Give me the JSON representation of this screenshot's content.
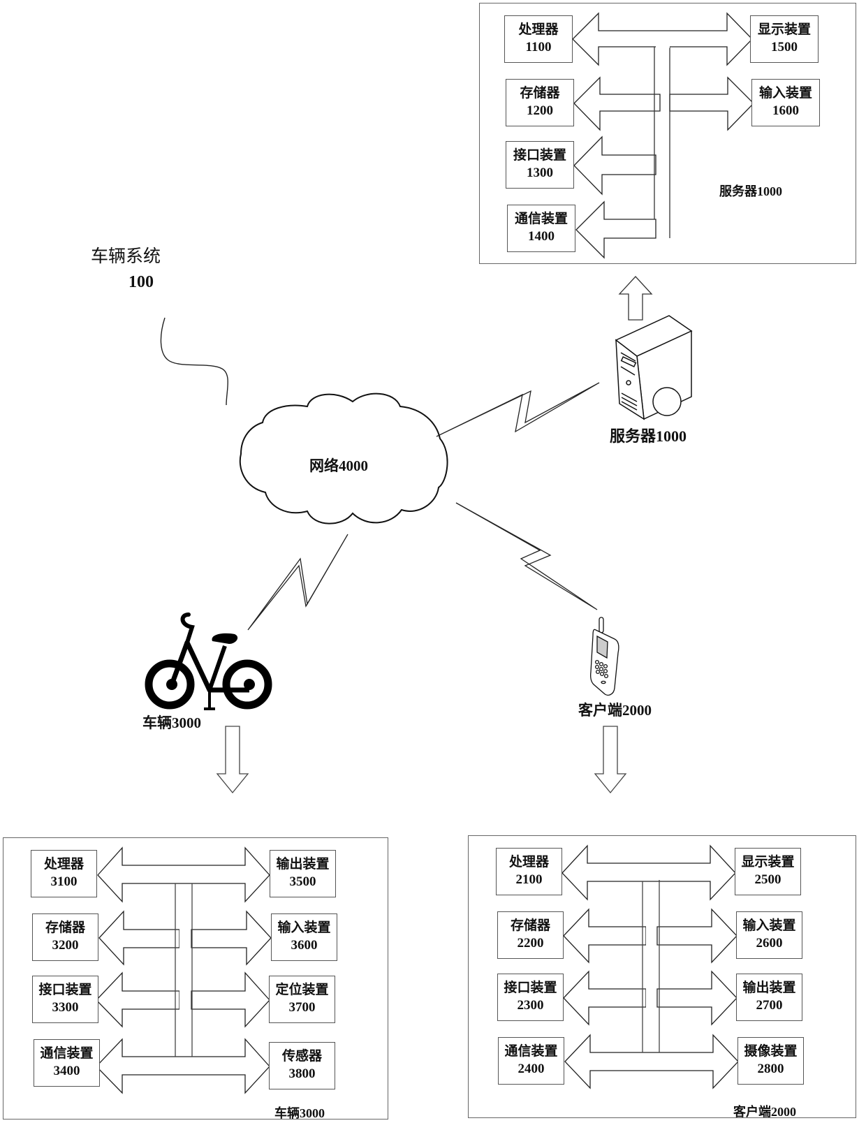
{
  "system": {
    "title": "车辆系统",
    "number": "100"
  },
  "network": {
    "label": "网络4000"
  },
  "server_icon": {
    "label": "服务器1000",
    "icon": "server-tower-icon"
  },
  "vehicle_icon": {
    "label": "车辆3000",
    "icon": "bicycle-icon"
  },
  "client_icon": {
    "label": "客户端2000",
    "icon": "mobile-phone-icon"
  },
  "server_panel": {
    "caption": "服务器1000",
    "left": [
      {
        "name": "处理器",
        "num": "1100"
      },
      {
        "name": "存储器",
        "num": "1200"
      },
      {
        "name": "接口装置",
        "num": "1300"
      },
      {
        "name": "通信装置",
        "num": "1400"
      }
    ],
    "right": [
      {
        "name": "显示装置",
        "num": "1500"
      },
      {
        "name": "输入装置",
        "num": "1600"
      }
    ]
  },
  "vehicle_panel": {
    "caption": "车辆3000",
    "left": [
      {
        "name": "处理器",
        "num": "3100"
      },
      {
        "name": "存储器",
        "num": "3200"
      },
      {
        "name": "接口装置",
        "num": "3300"
      },
      {
        "name": "通信装置",
        "num": "3400"
      }
    ],
    "right": [
      {
        "name": "输出装置",
        "num": "3500"
      },
      {
        "name": "输入装置",
        "num": "3600"
      },
      {
        "name": "定位装置",
        "num": "3700"
      },
      {
        "name": "传感器",
        "num": "3800"
      }
    ]
  },
  "client_panel": {
    "caption": "客户端2000",
    "left": [
      {
        "name": "处理器",
        "num": "2100"
      },
      {
        "name": "存储器",
        "num": "2200"
      },
      {
        "name": "接口装置",
        "num": "2300"
      },
      {
        "name": "通信装置",
        "num": "2400"
      }
    ],
    "right": [
      {
        "name": "显示装置",
        "num": "2500"
      },
      {
        "name": "输入装置",
        "num": "2600"
      },
      {
        "name": "输出装置",
        "num": "2700"
      },
      {
        "name": "摄像装置",
        "num": "2800"
      }
    ]
  }
}
